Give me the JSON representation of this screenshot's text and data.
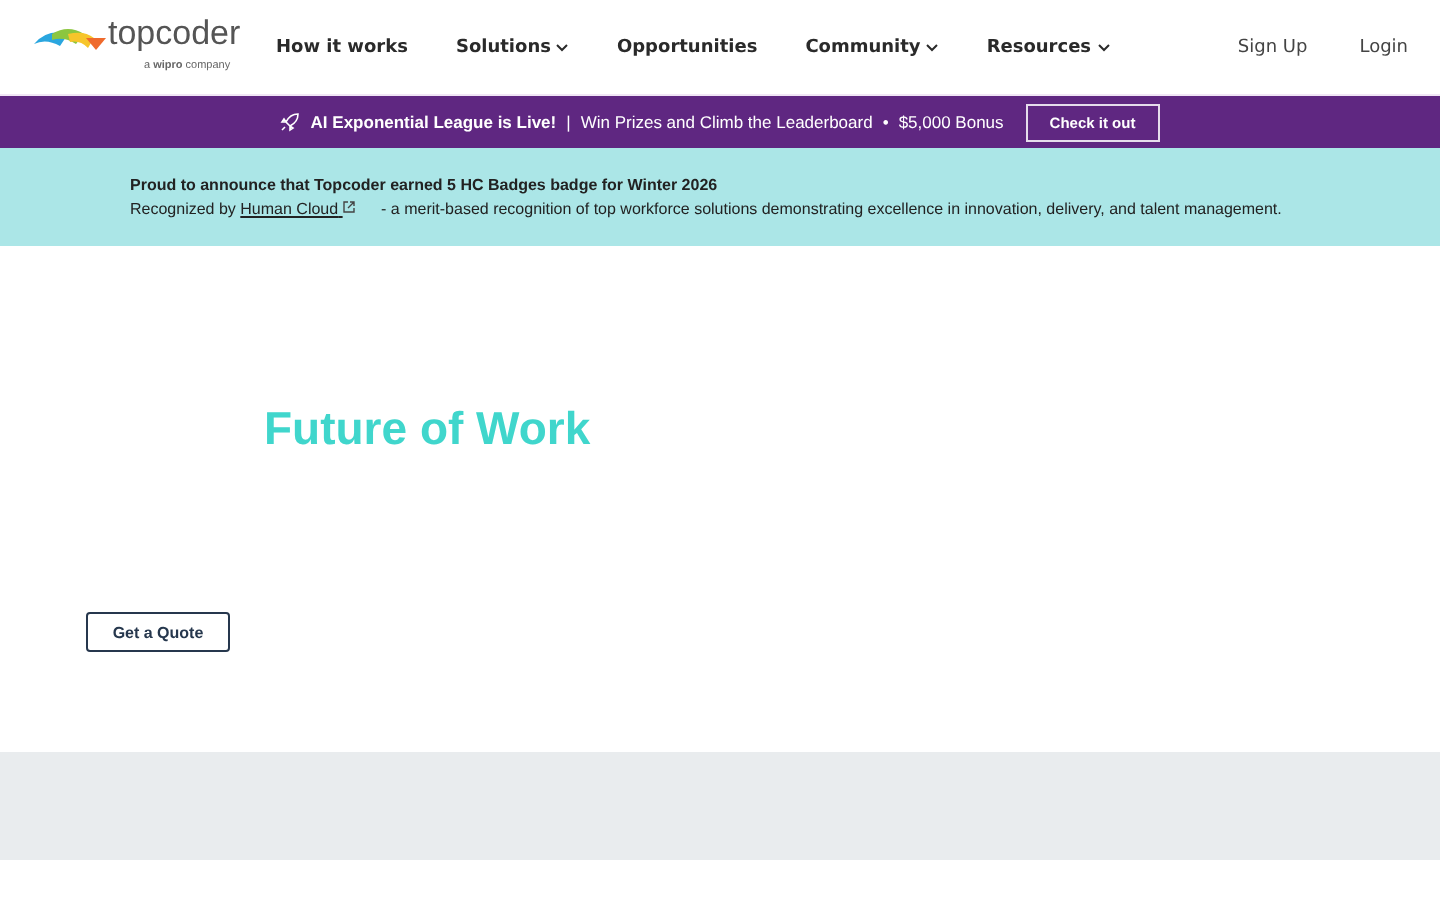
{
  "header": {
    "logo": {
      "name": "topcoder",
      "tagline": "a **wipro** company"
    },
    "nav": [
      {
        "label": "How it works",
        "has_menu": false
      },
      {
        "label": "Solutions",
        "has_menu": true
      },
      {
        "label": "Opportunities",
        "has_menu": false
      },
      {
        "label": "Community",
        "has_menu": true
      },
      {
        "label": "Resources",
        "has_menu": true
      }
    ],
    "auth": [
      "Sign Up",
      "Login"
    ]
  },
  "promo_bar": {
    "headline": "AI Exponential League is Live!",
    "separator": "|",
    "message": "Win Prizes and Climb the Leaderboard",
    "bullet": "•",
    "bonus": "$5,000 Bonus",
    "button": "Check it out"
  },
  "announcement": {
    "title": "Proud to announce that Topcoder earned 5 HC Badges badge for Winter 2026",
    "prefix": "Recognized by",
    "link": "Human Cloud",
    "suffix": "- a merit-based recognition of top workforce solutions demonstrating excellence in innovation, delivery, and talent management."
  },
  "hero": {
    "title": "Future of Work",
    "button": "Get a Quote"
  }
}
